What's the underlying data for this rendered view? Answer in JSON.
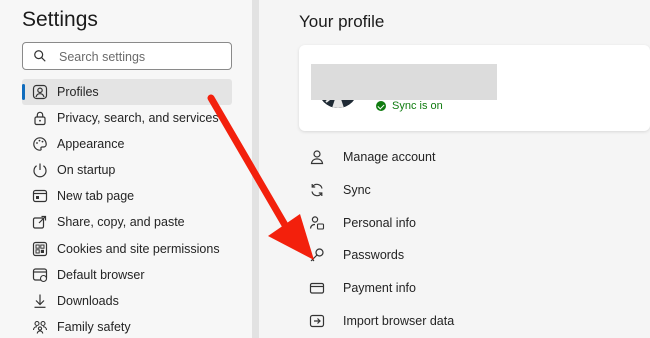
{
  "settings": {
    "title": "Settings",
    "search_placeholder": "Search settings",
    "nav": [
      {
        "label": "Profiles",
        "icon": "profile-icon",
        "active": true
      },
      {
        "label": "Privacy, search, and services",
        "icon": "lock-icon"
      },
      {
        "label": "Appearance",
        "icon": "appearance-icon"
      },
      {
        "label": "On startup",
        "icon": "power-icon"
      },
      {
        "label": "New tab page",
        "icon": "new-tab-icon"
      },
      {
        "label": "Share, copy, and paste",
        "icon": "share-icon"
      },
      {
        "label": "Cookies and site permissions",
        "icon": "cookies-icon"
      },
      {
        "label": "Default browser",
        "icon": "default-browser-icon"
      },
      {
        "label": "Downloads",
        "icon": "download-icon"
      },
      {
        "label": "Family safety",
        "icon": "family-icon"
      }
    ]
  },
  "profile": {
    "title": "Your profile",
    "sync_status": "Sync is on",
    "items": [
      {
        "label": "Manage account",
        "icon": "person-icon"
      },
      {
        "label": "Sync",
        "icon": "sync-icon"
      },
      {
        "label": "Personal info",
        "icon": "personal-info-icon"
      },
      {
        "label": "Passwords",
        "icon": "key-icon"
      },
      {
        "label": "Payment info",
        "icon": "card-icon"
      },
      {
        "label": "Import browser data",
        "icon": "import-icon"
      }
    ]
  },
  "colors": {
    "accent": "#0f6cbd",
    "sync_green": "#107c10",
    "arrow_red": "#f3200c"
  }
}
